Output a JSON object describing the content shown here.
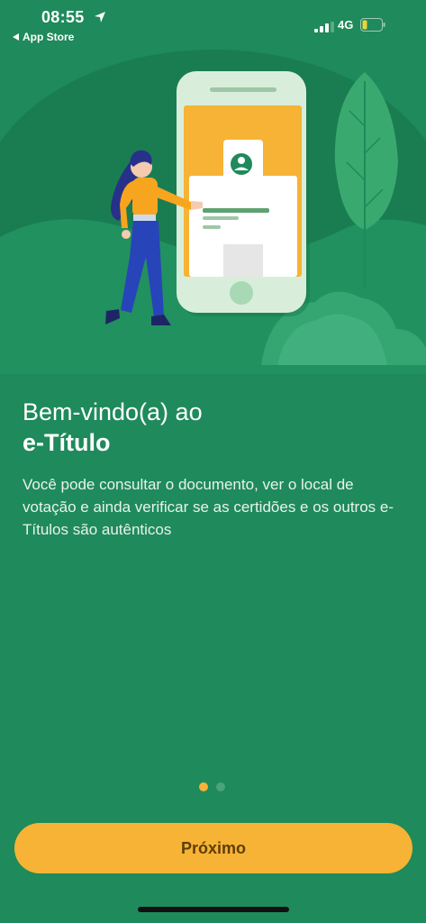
{
  "status_bar": {
    "time": "08:55",
    "back_app_label": "App Store",
    "network": "4G",
    "icons": [
      "location-arrow-icon",
      "signal-icon",
      "battery-icon"
    ]
  },
  "onboarding": {
    "title_line1": "Bem-vindo(a) ao",
    "title_line2": "e-Título",
    "description": "Você pode consultar o documento, ver o local de votação e ainda verificar se as certidões e os outros e-Títulos são autênticos",
    "page_index": 1,
    "page_count": 2
  },
  "actions": {
    "next_label": "Próximo"
  },
  "colors": {
    "background": "#1f8a5b",
    "accent": "#f7b335",
    "button_text": "#5d3e06"
  }
}
